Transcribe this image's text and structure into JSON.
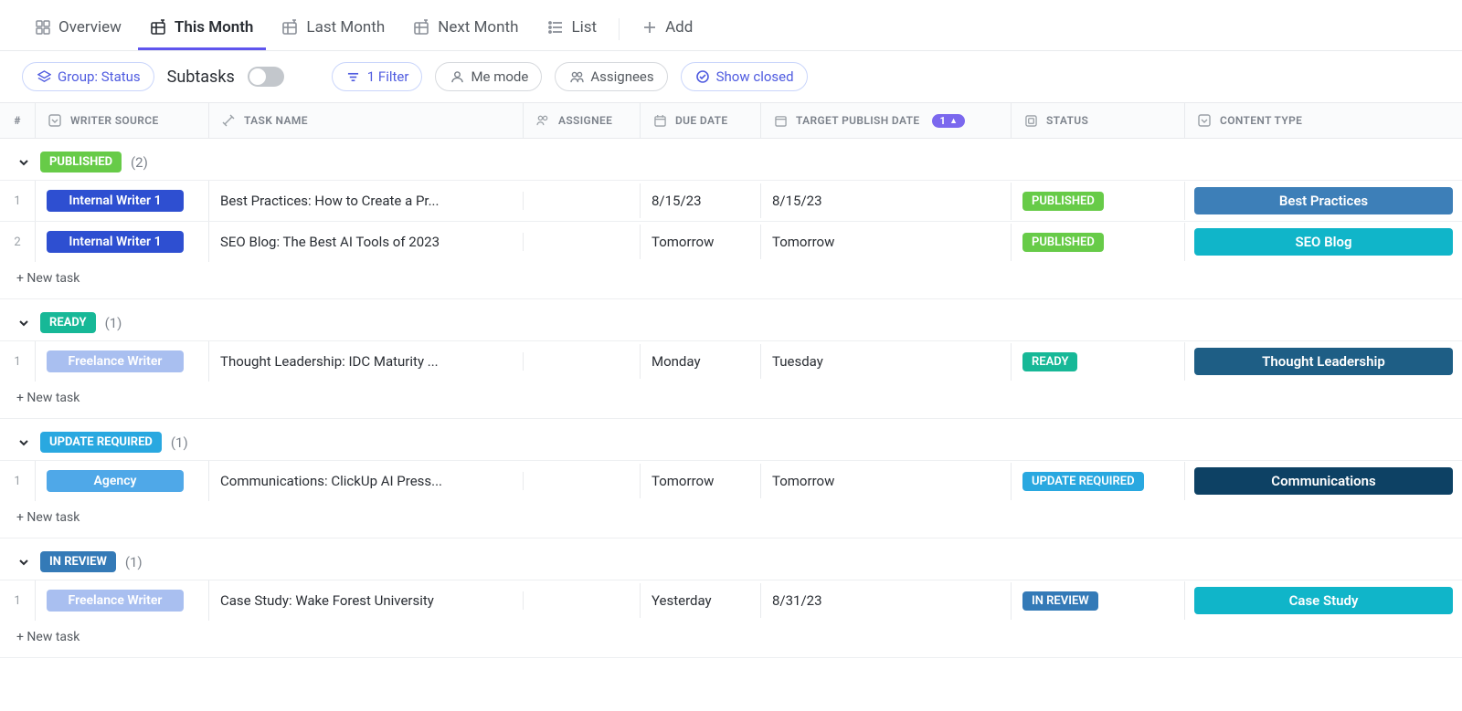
{
  "views": {
    "tabs": [
      {
        "id": "overview",
        "label": "Overview",
        "icon": "grid"
      },
      {
        "id": "this-month",
        "label": "This Month",
        "icon": "table-pin",
        "active": true
      },
      {
        "id": "last-month",
        "label": "Last Month",
        "icon": "table-pin"
      },
      {
        "id": "next-month",
        "label": "Next Month",
        "icon": "table-pin"
      },
      {
        "id": "list",
        "label": "List",
        "icon": "list"
      }
    ],
    "add_label": "Add"
  },
  "toolbar": {
    "group_label": "Group: Status",
    "subtasks_label": "Subtasks",
    "filter_label": "1 Filter",
    "me_mode_label": "Me mode",
    "assignees_label": "Assignees",
    "show_closed_label": "Show closed"
  },
  "columns": {
    "num": "#",
    "writer_source": "WRITER SOURCE",
    "task_name": "TASK NAME",
    "assignee": "ASSIGNEE",
    "due_date": "DUE DATE",
    "target_publish": "TARGET PUBLISH DATE",
    "target_sort_count": "1",
    "status": "STATUS",
    "content_type": "CONTENT TYPE"
  },
  "new_task_label": "+ New task",
  "groups": [
    {
      "status": "PUBLISHED",
      "status_bg": "#67cb48",
      "count": "(2)",
      "rows": [
        {
          "n": "1",
          "src": "Internal Writer 1",
          "src_bg": "#2e4fd1",
          "task": "Best Practices: How to Create a Pr...",
          "due": "8/15/23",
          "target": "8/15/23",
          "status": "PUBLISHED",
          "status_bg": "#67cb48",
          "type": "Best Practices",
          "type_bg": "#3d7fb8"
        },
        {
          "n": "2",
          "src": "Internal Writer 1",
          "src_bg": "#2e4fd1",
          "task": "SEO Blog: The Best AI Tools of 2023",
          "due": "Tomorrow",
          "target": "Tomorrow",
          "status": "PUBLISHED",
          "status_bg": "#67cb48",
          "type": "SEO Blog",
          "type_bg": "#10b5c9"
        }
      ]
    },
    {
      "status": "READY",
      "status_bg": "#17b897",
      "count": "(1)",
      "rows": [
        {
          "n": "1",
          "src": "Freelance Writer",
          "src_bg": "#a9bff0",
          "task": "Thought Leadership: IDC Maturity ...",
          "due": "Monday",
          "target": "Tuesday",
          "status": "READY",
          "status_bg": "#17b897",
          "type": "Thought Leadership",
          "type_bg": "#1e5e85"
        }
      ]
    },
    {
      "status": "UPDATE REQUIRED",
      "status_bg": "#29a8e0",
      "count": "(1)",
      "rows": [
        {
          "n": "1",
          "src": "Agency",
          "src_bg": "#4fa8e8",
          "task": "Communications: ClickUp AI Press...",
          "due": "Tomorrow",
          "target": "Tomorrow",
          "status": "UPDATE REQUIRED",
          "status_bg": "#29a8e0",
          "type": "Communications",
          "type_bg": "#0d4164"
        }
      ]
    },
    {
      "status": "IN REVIEW",
      "status_bg": "#347ab7",
      "count": "(1)",
      "rows": [
        {
          "n": "1",
          "src": "Freelance Writer",
          "src_bg": "#a9bff0",
          "task": "Case Study: Wake Forest University",
          "due": "Yesterday",
          "target": "8/31/23",
          "status": "IN REVIEW",
          "status_bg": "#347ab7",
          "type": "Case Study",
          "type_bg": "#10b5c9"
        }
      ]
    }
  ]
}
